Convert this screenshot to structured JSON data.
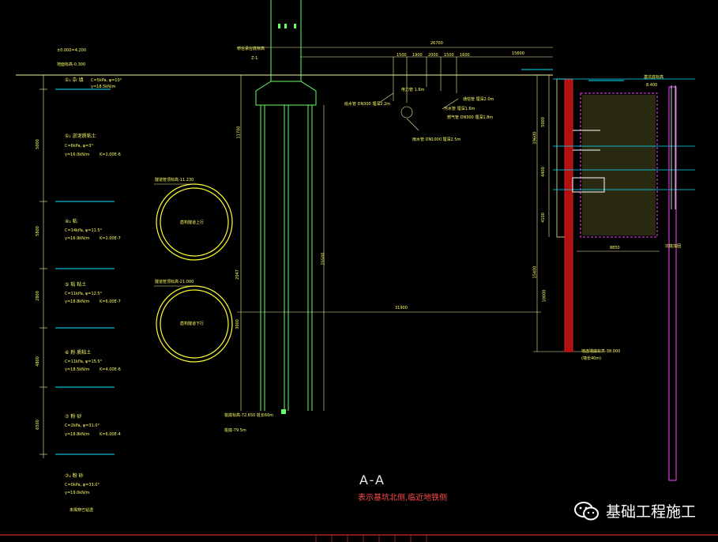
{
  "colors": {
    "background": "#000000",
    "structure": "#f2f2a0",
    "green": "#66ff66",
    "yellow": "#ffff00",
    "cyan": "#00e5ff",
    "red": "#ff2020",
    "magenta": "#ff40ff",
    "white": "#ffffff"
  },
  "top": {
    "elev_1": "±0.000=4.200",
    "elev_2": "地面标高-0.300",
    "beam_note": "桥台承台底标高",
    "beam_sub": "Z-1",
    "dim_total": "26700",
    "dim_right": "15600",
    "dims": [
      "1500",
      "1900",
      "2000",
      "1500",
      "1600"
    ],
    "right_elev": "8.400"
  },
  "soils": [
    {
      "id": "①₁",
      "name": "杂  填",
      "params": "C=5kPa, φ=10°",
      "gamma": "γ=18.5kN/m"
    },
    {
      "id": "①₂",
      "name": "淤泥质粘土",
      "params": "C=6kPa, φ=3°",
      "gamma": "γ=16.0kN/m",
      "k": "K=2.00E-6"
    },
    {
      "id": "④₂",
      "name": "粘",
      "params": "C=14kPa, φ=11.5°",
      "gamma": "γ=16.9kN/m",
      "k": "K=2.00E-7"
    },
    {
      "id": "⑤",
      "name": "粘  粘土",
      "params": "C=11kPa, φ=12.5°",
      "gamma": "γ=18.8kN/m",
      "k": "K=6.00E-7"
    },
    {
      "id": "⑥",
      "name": "粉  质粘土",
      "params": "C=11kPa, φ=15.5°",
      "gamma": "γ=18.5kN/m",
      "k": "K=4.00E-6"
    },
    {
      "id": "⑦",
      "name": "粉  砂",
      "params": "C=2kPa, φ=31.0°",
      "gamma": "γ=18.8kN/m",
      "k": "K=6.00E-4"
    },
    {
      "id": "⑦₂",
      "name": "粉  砂",
      "params": "C=0kPa, φ=33.0°",
      "gamma": "γ=19.0kN/m",
      "extra": "未揭穿已钻透"
    }
  ],
  "left_dims": [
    "5000",
    "5800",
    "2800",
    "4800",
    "6500"
  ],
  "tunnels": [
    {
      "label": "隧道管顶标高-11.230",
      "inner": "盾构隧道上行"
    },
    {
      "label": "隧道管顶标高-21.000",
      "inner": "盾构隧道下行"
    }
  ],
  "pile_note": "桩底标高-72.650\n桩长60m",
  "pile_note_bottom": "桩底-79.5m",
  "mid_dims": [
    "11700",
    "25500",
    "2047",
    "3000"
  ],
  "horizontal_dim": "31900",
  "pipes": {
    "p1": "给水管 DN300 埋深2.2m",
    "p2": "电力管 1.6m",
    "p3": "雨水管 DN1000 埋深2.5m",
    "p4": "污水管 埋深1.6m",
    "p5": "燃气管 DN300 埋深1.8m",
    "p6": "通信管 埋深2.0m"
  },
  "right_dims": {
    "d1": "5000",
    "d2": "19600",
    "d3": "4400",
    "d4": "4100",
    "d5": "15400",
    "d6": "10000",
    "d7": "8850"
  },
  "pit_notes": {
    "n1": "基坑底标高",
    "n2": "坑底加固",
    "n3": "地连墙底标高-38.000",
    "n4": "(墙长40m)"
  },
  "section": {
    "title": "A-A",
    "subtitle": "表示基坑北侧,临近地铁侧"
  },
  "watermark": "基础工程施工"
}
